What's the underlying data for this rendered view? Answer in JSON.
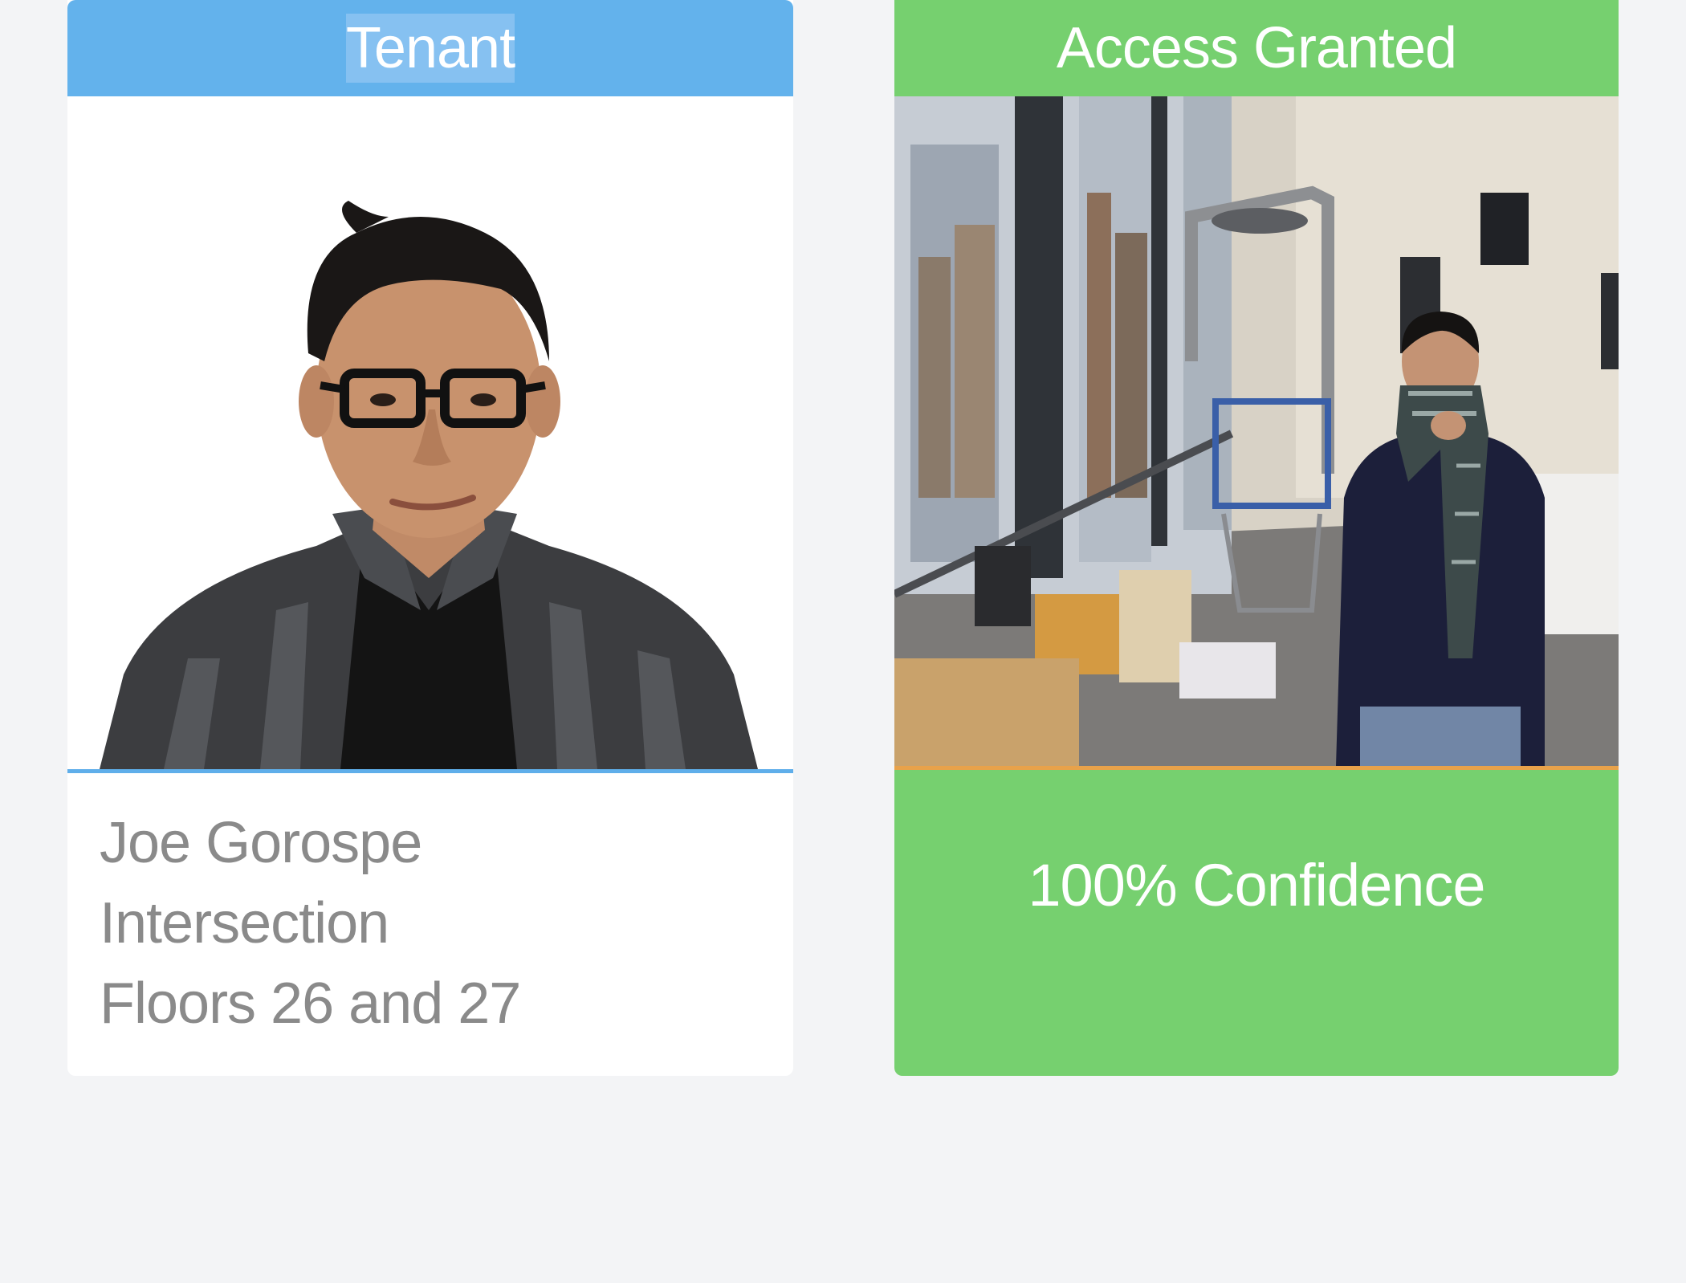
{
  "tenant_card": {
    "header": "Tenant",
    "name": "Joe Gorospe",
    "company": "Intersection",
    "floors": "Floors 26 and 27",
    "photo_icon": "person-portrait-icon"
  },
  "access_card": {
    "header": "Access Granted",
    "confidence": "100% Confidence",
    "camera_icon": "camera-feed-icon"
  },
  "colors": {
    "tenant_header": "#63b2ec",
    "access_green": "#76d06f",
    "camera_rule": "#e8a24a",
    "text_gray": "#8a8a8a",
    "background": "#f3f4f6"
  }
}
